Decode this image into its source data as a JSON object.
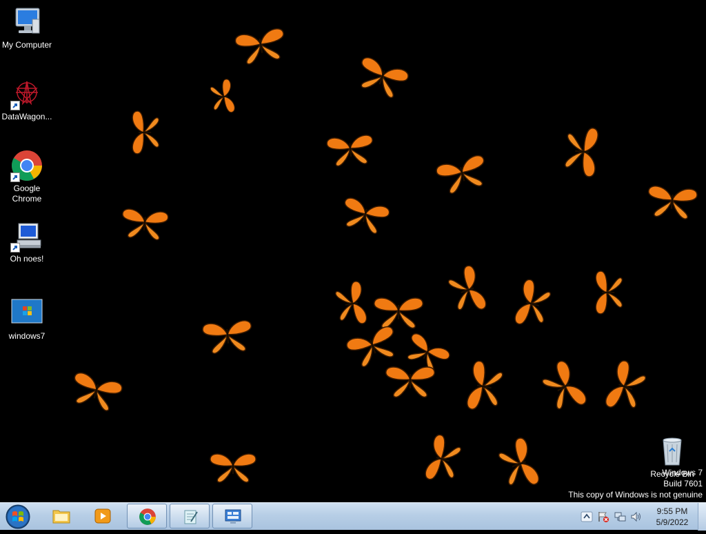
{
  "desktop": {
    "icons": [
      {
        "label": "My Computer",
        "icon": "computer-icon",
        "shortcut": false
      },
      {
        "label": "DataWagon...",
        "icon": "datawagon-icon",
        "shortcut": true
      },
      {
        "label": "Google Chrome",
        "icon": "chrome-icon",
        "shortcut": true
      },
      {
        "label": "Oh noes!",
        "icon": "oh-noes-icon",
        "shortcut": true
      },
      {
        "label": "windows7",
        "icon": "windows7-image-icon",
        "shortcut": false
      },
      {
        "label": "Recycle Bin",
        "icon": "recycle-bin-icon",
        "shortcut": false
      }
    ],
    "wallpaper": "orange monarch butterflies on black",
    "butterfly_color": "#f07a12"
  },
  "watermark": {
    "line1": "Windows 7",
    "line2": "Build 7601",
    "line3": "This copy of Windows is not genuine"
  },
  "taskbar": {
    "start_icon": "windows-start-orb-icon",
    "pinned": [
      {
        "name": "file-explorer",
        "icon": "folder-icon"
      },
      {
        "name": "media-player",
        "icon": "media-player-icon"
      },
      {
        "name": "chrome",
        "icon": "chrome-icon"
      },
      {
        "name": "notepad",
        "icon": "notepad-icon"
      },
      {
        "name": "control-panel",
        "icon": "control-panel-icon"
      }
    ],
    "tray_icons": [
      "show-hidden-icons-icon",
      "action-center-flag-icon",
      "network-icon",
      "volume-icon"
    ],
    "clock": {
      "time": "9:55 PM",
      "date": "5/9/2022"
    }
  }
}
